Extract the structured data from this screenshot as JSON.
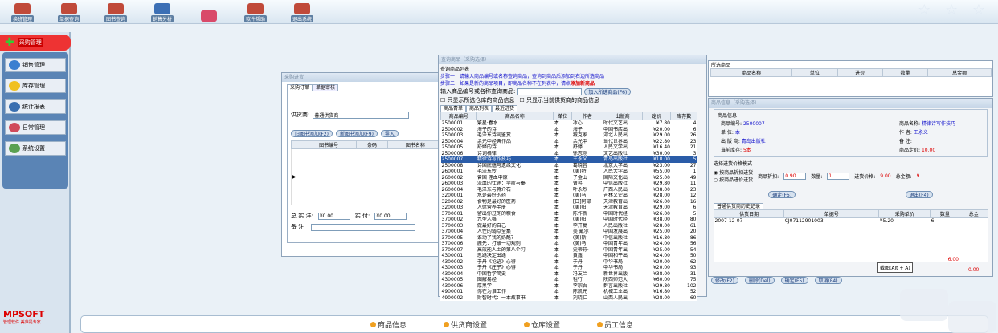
{
  "toolbar": {
    "buttons": [
      {
        "label": "换班管理",
        "icon": "swap-shift-icon",
        "color": "#c04a3a"
      },
      {
        "label": "单据查询",
        "icon": "document-query-icon",
        "color": "#c04a3a"
      },
      {
        "label": "图书查询",
        "icon": "book-query-icon",
        "color": "#c04a3a"
      },
      {
        "label": "销售分析",
        "icon": "sales-analysis-icon",
        "color": "#3b6fb5"
      },
      {
        "label": "",
        "icon": "mail-icon",
        "color": "#d94a6a"
      },
      {
        "label": "软件帮助",
        "icon": "help-icon",
        "color": "#c04a3a"
      },
      {
        "label": "退出系统",
        "icon": "exit-icon",
        "color": "#c04a3a"
      }
    ]
  },
  "sidebar": {
    "header": "采购管理",
    "items": [
      {
        "label": "销售管理",
        "icon": "globe-icon",
        "color": "#3a7fd0"
      },
      {
        "label": "库存管理",
        "icon": "star-icon",
        "color": "#f0c020"
      },
      {
        "label": "统计报表",
        "icon": "chart-icon",
        "color": "#3a6fb0"
      },
      {
        "label": "日常管理",
        "icon": "heart-icon",
        "color": "#d04a5a"
      },
      {
        "label": "系统设置",
        "icon": "gear-icon",
        "color": "#5aa050"
      }
    ]
  },
  "logo": {
    "brand": "MPSOFT",
    "tagline": "管理软件 美萍是专家"
  },
  "bottom_nav": [
    "商品信息",
    "供货商设置",
    "仓库设置",
    "员工信息"
  ],
  "purchase_window": {
    "title": "采购进货",
    "tabs": [
      "采购订单",
      "单据审核"
    ],
    "supplier_label": "供货商:",
    "supplier_value": "普通供货商",
    "buttons": [
      "旧图书添加(F2)",
      "新图书添加(F9)",
      "导入"
    ],
    "columns": [
      "图书编号",
      "条码",
      "图书名称"
    ],
    "total_label": "总 实 洋:",
    "total_value": "¥0.00",
    "paid_label": "实    付:",
    "paid_value": "¥0.00",
    "note_label": "备    注:"
  },
  "query_window": {
    "title": "查询商品（采购选择）",
    "section": "查询商品列表",
    "step1": "步骤一：请输入商品编号或名称查询商品，查询到商品后添加到右边所选商品",
    "step2": "步骤二：如果是新的商品项目，即商品名称不在列表中，请点",
    "step2_link": "添加新商品",
    "search_label": "输入商品编号或名称查询商品:",
    "add_button": "加入所选商品(F6)",
    "check1": "只显示所选仓库的商品信息",
    "check2": "只显示当前供货商的商品信息",
    "tabs": [
      "商品青单",
      "商品列表",
      "最近进货"
    ],
    "columns": [
      "商品编号",
      "商品名称",
      "单位",
      "作者",
      "出版商",
      "定价",
      "库存数"
    ],
    "rows": [
      [
        "2500001",
        "繁星·春水",
        "本",
        "冰心",
        "时代文艺出",
        "¥7.80",
        "4"
      ],
      [
        "2500002",
        "海子的诗",
        "本",
        "海子",
        "中国书店出",
        "¥20.00",
        "6"
      ],
      [
        "2500003",
        "毛泽东诗词鉴赏",
        "本",
        "臧克家",
        "河北人民出",
        "¥29.00",
        "26"
      ],
      [
        "2500004",
        "余光中经典作品",
        "本",
        "余光中",
        "当代世界出",
        "¥22.80",
        "23"
      ],
      [
        "2500005",
        "舒婷的诗",
        "本",
        "舒婷",
        "人民文学出",
        "¥16.40",
        "21"
      ],
      [
        "2500006",
        "诗词格律",
        "本",
        "徐志刚",
        "文艺出版社",
        "¥30.00",
        "3"
      ],
      [
        "2500007",
        "精律诗写作技巧",
        "本",
        "王永义",
        "青岛出版社",
        "¥10.00",
        "5"
      ],
      [
        "2500008",
        "诗国底蕴与遗缘文化",
        "本",
        "葛晓音",
        "北京大学出",
        "¥23.00",
        "27"
      ],
      [
        "2600001",
        "毛泽东传",
        "本",
        "(美)特",
        "人民大学出",
        "¥55.00",
        "1"
      ],
      [
        "2600002",
        "曾国·理血中原",
        "本",
        "子金山",
        "国际文化出",
        "¥25.00",
        "49"
      ],
      [
        "2600003",
        "流血的仕途：李斯与秦",
        "本",
        "曹昇",
        "中信出版社",
        "¥29.80",
        "11"
      ],
      [
        "2600004",
        "毛泽东与蒋介石",
        "本",
        "叶永烈",
        "广西人民出",
        "¥38.00",
        "23"
      ],
      [
        "3200001",
        "水是最好的药",
        "本",
        "(美)马",
        "吉林文史出",
        "¥28.00",
        "12"
      ],
      [
        "3200002",
        "食物是最好的医药",
        "本",
        "[日]阿部",
        "天津教育出",
        "¥26.00",
        "16"
      ],
      [
        "3200003",
        "人体营养手册",
        "本",
        "(美)帕",
        "天津教育出",
        "¥29.00",
        "6"
      ],
      [
        "3700001",
        "留出你过冬的粮食",
        "本",
        "陈作新",
        "中国时代经",
        "¥26.00",
        "5"
      ],
      [
        "3700002",
        "九型人格",
        "本",
        "(美)帕",
        "中国时代经",
        "¥38.00",
        "80"
      ],
      [
        "3700003",
        "做最好的自己",
        "本",
        "李开复",
        "人民出版社",
        "¥28.00",
        "61"
      ],
      [
        "3700004",
        "人性的弱点全集",
        "本",
        "美 戴尔",
        "中国发展出",
        "¥25.00",
        "20"
      ],
      [
        "3700005",
        "谁动了我的奶酪？",
        "本",
        "(美)斯",
        "中信出版社",
        "¥16.80",
        "86"
      ],
      [
        "3700006",
        "鹿先：打破一切规则",
        "本",
        "(美)马",
        "中国青年出",
        "¥24.00",
        "56"
      ],
      [
        "3700007",
        "高效能人士的第八个习",
        "本",
        "史蒂芬·",
        "中国青年出",
        "¥25.00",
        "54"
      ],
      [
        "4300001",
        "思路决定出路",
        "本",
        "黄鑫",
        "中国和平出",
        "¥24.00",
        "50"
      ],
      [
        "4300002",
        "于丹《论语》心得",
        "本",
        "于丹",
        "中华书局",
        "¥20.00",
        "62"
      ],
      [
        "4300003",
        "于丹《庄子》心得",
        "本",
        "于丹",
        "中华书局",
        "¥20.00",
        "93"
      ],
      [
        "4300004",
        "中国哲学简史",
        "本",
        "冯友兰",
        "新世界出版",
        "¥38.00",
        "31"
      ],
      [
        "4300005",
        "图解易经",
        "本",
        "祖行",
        "陕西师范大",
        "¥60.00",
        "75"
      ],
      [
        "4300006",
        "厚黑学",
        "本",
        "李宗吾",
        "群言出版社",
        "¥29.80",
        "102"
      ],
      [
        "4900001",
        "你在为谁工作",
        "本",
        "陈凯元",
        "机械工业出",
        "¥16.80",
        "52"
      ],
      [
        "4900002",
        "财智时代：一本故事书",
        "本",
        "刘晓仁",
        "山西人民出",
        "¥28.00",
        "60"
      ]
    ],
    "selected_row": 6
  },
  "selected_panel": {
    "header": "所选商品",
    "columns": [
      "商品名称",
      "单位",
      "进价",
      "数量",
      "总金额"
    ]
  },
  "info_window": {
    "title": "商品信息（采购选择）",
    "section": "商品信息",
    "code_label": "商品编号:",
    "code_value": "2500007",
    "name_label": "商品名称:",
    "name_value": "精律诗写作技巧",
    "unit_label": "单    位:",
    "unit_value": "本",
    "author_label": "作    者:",
    "author_value": "王永义",
    "publisher_label": "出 版 商:",
    "publisher_value": "青岛出版社",
    "remark_label": "备    注:",
    "stock_label": "当前库存:",
    "stock_value": "5本",
    "price_label": "商品定价:",
    "price_value": "10.00",
    "mode_title": "选择进货价格模式",
    "mode1": "按商品折扣进货",
    "mode2": "按商品进价进货",
    "discount_label": "商品折扣:",
    "discount_value": "0.90",
    "qty_label": "数量:",
    "qty_value": "1",
    "cost_label": "进货价格:",
    "cost_value": "9.00",
    "amount_label": "总金额:",
    "amount_value": "9",
    "ok_button": "确定(F5)",
    "cancel_button": "退出(F4)",
    "history_tab": "普通供货商历史记录",
    "history_columns": [
      "供货日期",
      "单据号",
      "采购单价",
      "数量",
      "总金"
    ],
    "history_rows": [
      [
        "2007-12-07",
        "CJ07112901003",
        "¥5.20",
        "6",
        ""
      ]
    ],
    "history_total": "6.00"
  },
  "bottom_buttons": [
    "修改(F2)",
    "删除(Del)",
    "确定(F5)",
    "取消(F4)"
  ],
  "screenshot_tip": "截图(Alt + A)",
  "right_total": "0.00"
}
